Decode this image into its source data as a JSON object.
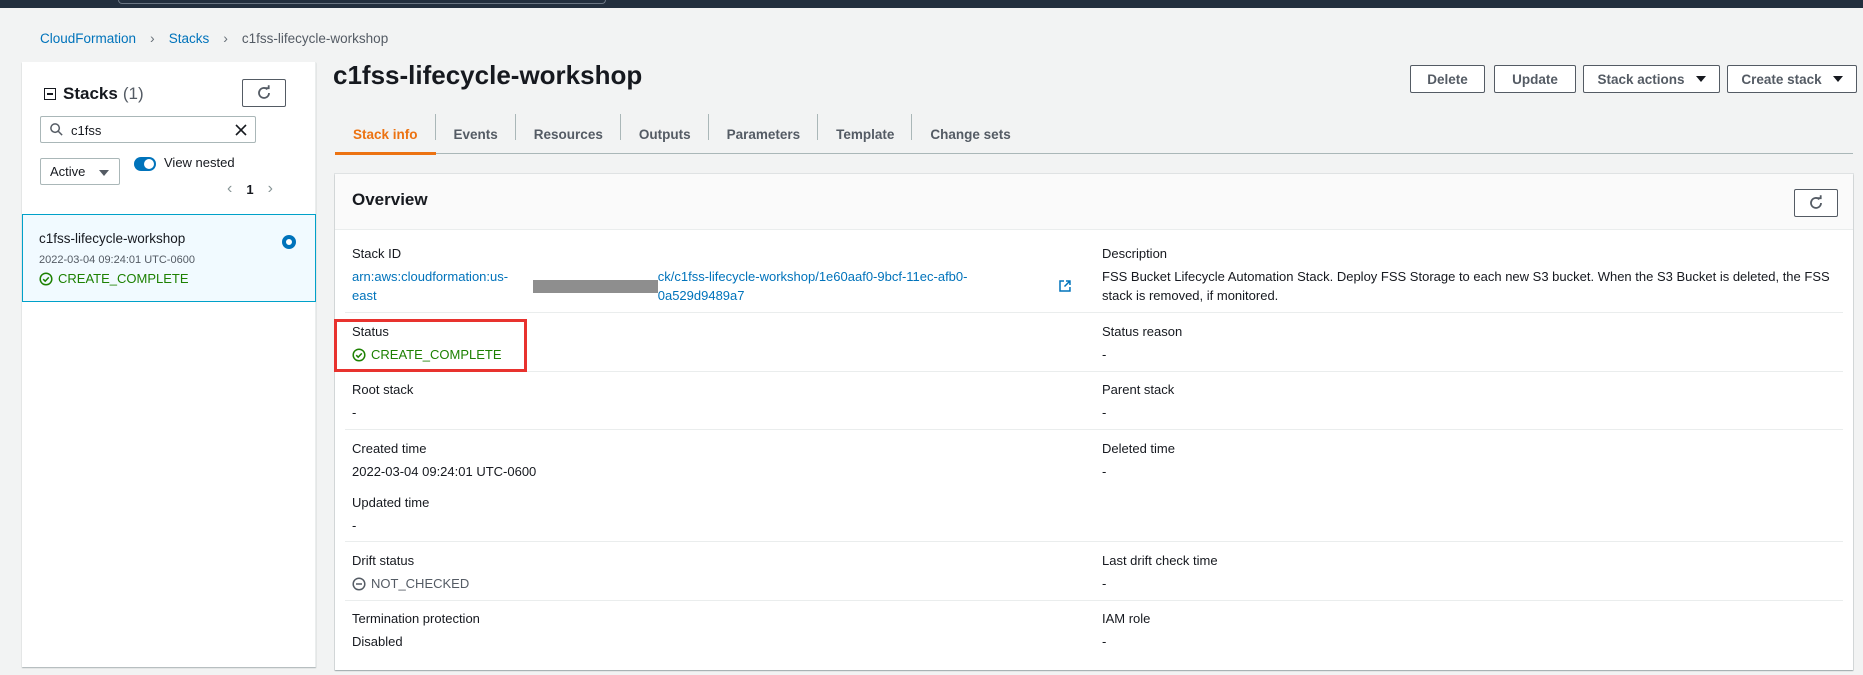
{
  "breadcrumb": {
    "item1": "CloudFormation",
    "item2": "Stacks",
    "current": "c1fss-lifecycle-workshop"
  },
  "left_panel": {
    "title": "Stacks",
    "count": "(1)",
    "search_value": "c1fss",
    "filter_value": "Active",
    "view_nested_label": "View nested",
    "page_number": "1",
    "stack": {
      "name": "c1fss-lifecycle-workshop",
      "created": "2022-03-04 09:24:01 UTC-0600",
      "status": "CREATE_COMPLETE"
    }
  },
  "main": {
    "title": "c1fss-lifecycle-workshop",
    "buttons": {
      "delete": "Delete",
      "update": "Update",
      "stack_actions": "Stack actions",
      "create_stack": "Create stack"
    },
    "tabs": [
      "Stack info",
      "Events",
      "Resources",
      "Outputs",
      "Parameters",
      "Template",
      "Change sets"
    ],
    "active_tab": "Stack info"
  },
  "overview": {
    "title": "Overview",
    "stack_id_label": "Stack ID",
    "stack_id_prefix": "arn:aws:cloudformation:us-east",
    "stack_id_suffix": "ck/c1fss-lifecycle-workshop/1e60aaf0-9bcf-11ec-afb0-0a529d9489a7",
    "description_label": "Description",
    "description_value": "FSS Bucket Lifecycle Automation Stack. Deploy FSS Storage to each new S3 bucket. When the S3 Bucket is deleted, the FSS stack is removed, if monitored.",
    "status_label": "Status",
    "status_value": "CREATE_COMPLETE",
    "status_reason_label": "Status reason",
    "status_reason_value": "-",
    "root_stack_label": "Root stack",
    "root_stack_value": "-",
    "parent_stack_label": "Parent stack",
    "parent_stack_value": "-",
    "created_time_label": "Created time",
    "created_time_value": "2022-03-04 09:24:01 UTC-0600",
    "deleted_time_label": "Deleted time",
    "deleted_time_value": "-",
    "updated_time_label": "Updated time",
    "updated_time_value": "-",
    "drift_status_label": "Drift status",
    "drift_status_value": "NOT_CHECKED",
    "last_drift_label": "Last drift check time",
    "last_drift_value": "-",
    "termination_label": "Termination protection",
    "termination_value": "Disabled",
    "iam_role_label": "IAM role",
    "iam_role_value": "-"
  },
  "colors": {
    "link": "#0073bb",
    "success": "#1d8102",
    "active_tab": "#ec7211",
    "highlight": "#e8322e"
  }
}
